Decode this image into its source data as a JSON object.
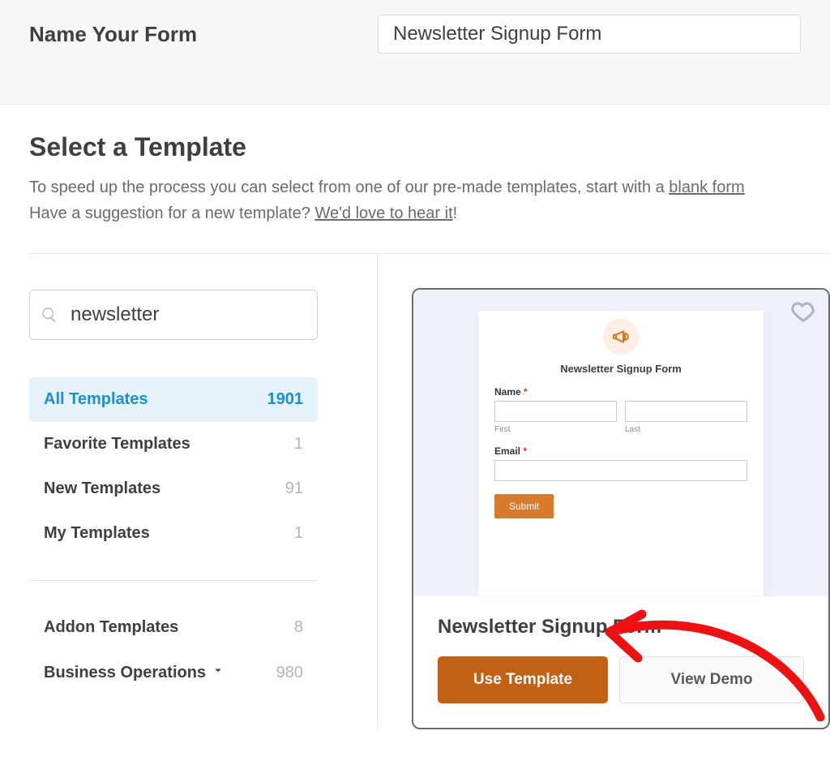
{
  "header": {
    "name_label": "Name Your Form",
    "name_value": "Newsletter Signup Form"
  },
  "section": {
    "title": "Select a Template",
    "description_prefix": "To speed up the process you can select from one of our pre-made templates, start with a ",
    "blank_link": "blank form",
    "suggestion_prefix": "Have a suggestion for a new template? ",
    "suggestion_link": "We'd love to hear it",
    "suggestion_suffix": "!"
  },
  "search": {
    "value": "newsletter"
  },
  "categories": {
    "primary": [
      {
        "label": "All Templates",
        "count": "1901",
        "active": true
      },
      {
        "label": "Favorite Templates",
        "count": "1",
        "active": false
      },
      {
        "label": "New Templates",
        "count": "91",
        "active": false
      },
      {
        "label": "My Templates",
        "count": "1",
        "active": false
      }
    ],
    "secondary": [
      {
        "label": "Addon Templates",
        "count": "8",
        "chevron": false
      },
      {
        "label": "Business Operations",
        "count": "980",
        "chevron": true
      }
    ]
  },
  "template_card": {
    "title": "Newsletter Signup Form",
    "use_label": "Use Template",
    "demo_label": "View Demo",
    "preview": {
      "form_title": "Newsletter Signup Form",
      "name_label": "Name",
      "first_sub": "First",
      "last_sub": "Last",
      "email_label": "Email",
      "submit": "Submit"
    }
  }
}
